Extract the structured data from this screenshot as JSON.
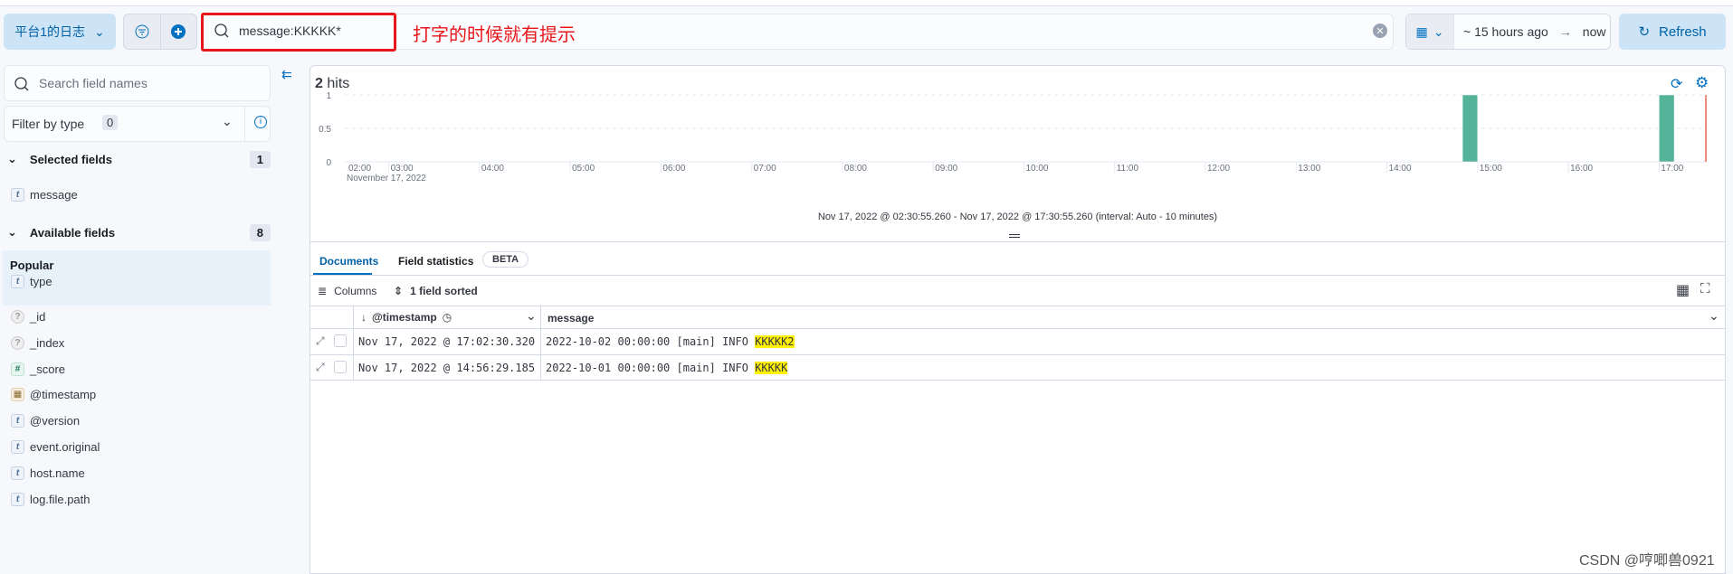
{
  "toolbar": {
    "data_view": "平台1的日志",
    "query": "message:KKKKK*",
    "annotation": "打字的时候就有提示",
    "date_start": "~ 15 hours ago",
    "date_end": "now",
    "refresh": "Refresh"
  },
  "sidebar": {
    "search_placeholder": "Search field names",
    "filter_label": "Filter by type",
    "filter_count": "0",
    "selected_label": "Selected fields",
    "selected_count": "1",
    "selected": [
      {
        "type": "t",
        "name": "message"
      }
    ],
    "available_label": "Available fields",
    "available_count": "8",
    "popular_label": "Popular",
    "popular": [
      {
        "type": "t",
        "name": "type"
      }
    ],
    "fields": [
      {
        "type": "?",
        "name": "_id"
      },
      {
        "type": "?",
        "name": "_index"
      },
      {
        "type": "#",
        "name": "_score"
      },
      {
        "type": "date",
        "name": "@timestamp"
      },
      {
        "type": "t",
        "name": "@version"
      },
      {
        "type": "t",
        "name": "event.original"
      },
      {
        "type": "t",
        "name": "host.name"
      },
      {
        "type": "t",
        "name": "log.file.path"
      }
    ]
  },
  "main": {
    "hits_count": "2",
    "hits_label": "hits",
    "caption": "Nov 17, 2022 @ 02:30:55.260 - Nov 17, 2022 @ 17:30:55.260 (interval: Auto - 10 minutes)",
    "tabs": [
      {
        "label": "Documents"
      },
      {
        "label": "Field statistics"
      }
    ],
    "beta": "BETA",
    "columns_label": "Columns",
    "sorted_label": "1 field sorted",
    "col_timestamp": "@timestamp",
    "col_message": "message",
    "rows": [
      {
        "timestamp": "Nov 17, 2022 @ 17:02:30.320",
        "msg_prefix": "2022-10-02 00:00:00 [main] INFO ",
        "msg_highlight": "KKKKK2"
      },
      {
        "timestamp": "Nov 17, 2022 @ 14:56:29.185",
        "msg_prefix": "2022-10-01 00:00:00 [main] INFO ",
        "msg_highlight": "KKKKK"
      }
    ]
  },
  "chart_data": {
    "type": "bar",
    "x_range": [
      "02:30:55",
      "17:30:55"
    ],
    "date_label": "November 17, 2022",
    "x_ticks": [
      "02:00",
      "03:00",
      "04:00",
      "05:00",
      "06:00",
      "07:00",
      "08:00",
      "09:00",
      "10:00",
      "11:00",
      "12:00",
      "13:00",
      "14:00",
      "15:00",
      "16:00",
      "17:00"
    ],
    "y_ticks": [
      "0",
      "0.5",
      "1"
    ],
    "ylim": [
      0,
      1
    ],
    "interval_minutes": 10,
    "bars": [
      {
        "start": "14:50",
        "value": 1
      },
      {
        "start": "17:00",
        "value": 1
      }
    ],
    "now_marker": "17:30:55",
    "bar_color": "#54b399",
    "marker_color": "#e7664c",
    "grid": true
  },
  "watermark": "CSDN @哼唧兽0921"
}
